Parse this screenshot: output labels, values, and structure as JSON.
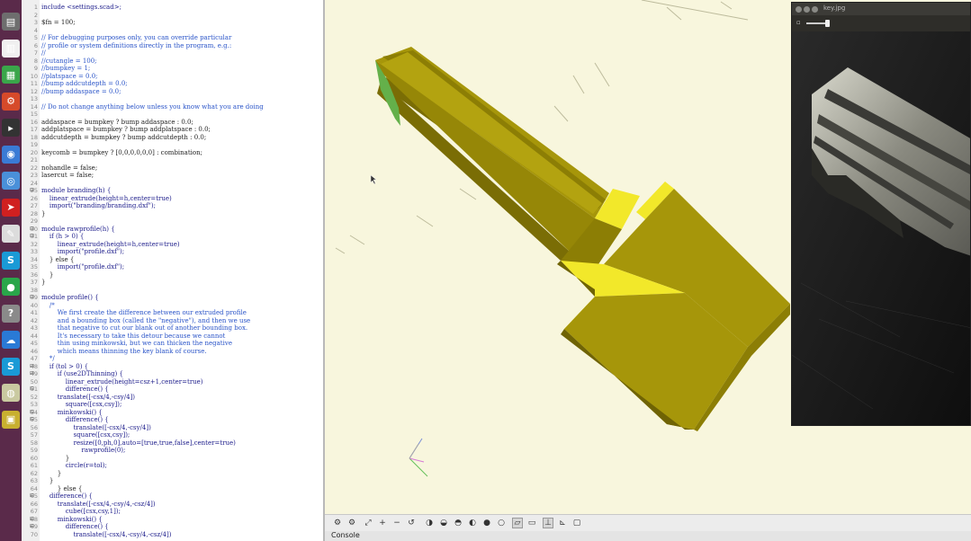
{
  "editor": {
    "lines": [
      {
        "n": "1",
        "text": "include <settings.scad>;",
        "style": "k"
      },
      {
        "n": "2",
        "text": "",
        "style": ""
      },
      {
        "n": "3",
        "text": "$fn = 100;",
        "style": ""
      },
      {
        "n": "4",
        "text": "",
        "style": ""
      },
      {
        "n": "5",
        "text": "// For debugging purposes only, you can override particular",
        "style": "c"
      },
      {
        "n": "6",
        "text": "// profile or system definitions directly in the program, e.g.:",
        "style": "c"
      },
      {
        "n": "7",
        "text": "//",
        "style": "c"
      },
      {
        "n": "8",
        "text": "//cutangle = 100;",
        "style": "c"
      },
      {
        "n": "9",
        "text": "//bumpkey = 1;",
        "style": "c"
      },
      {
        "n": "10",
        "text": "//platspace = 0.0;",
        "style": "c"
      },
      {
        "n": "11",
        "text": "//bump addcutdepth = 0.0;",
        "style": "c"
      },
      {
        "n": "12",
        "text": "//bump addaspace = 0.0;",
        "style": "c"
      },
      {
        "n": "13",
        "text": "",
        "style": ""
      },
      {
        "n": "14",
        "text": "// Do not change anything below unless you know what you are doing",
        "style": "c"
      },
      {
        "n": "15",
        "text": "",
        "style": ""
      },
      {
        "n": "16",
        "text": "addaspace = bumpkey ? bump addaspace : 0.0;",
        "style": ""
      },
      {
        "n": "17",
        "text": "addplatspace = bumpkey ? bump addplatspace : 0.0;",
        "style": ""
      },
      {
        "n": "18",
        "text": "addcutdepth = bumpkey ? bump addcutdepth : 0.0;",
        "style": ""
      },
      {
        "n": "19",
        "text": "",
        "style": ""
      },
      {
        "n": "20",
        "text": "keycomb = bumpkey ? [0,0,0,0,0,0] : combination;",
        "style": ""
      },
      {
        "n": "21",
        "text": "",
        "style": ""
      },
      {
        "n": "22",
        "text": "nohandle = false;",
        "style": ""
      },
      {
        "n": "23",
        "text": "lasercut = false;",
        "style": ""
      },
      {
        "n": "24",
        "text": "",
        "style": ""
      },
      {
        "n": "25",
        "text": "module branding(h) {",
        "style": "k",
        "fold": "⊟"
      },
      {
        "n": "26",
        "text": "    linear_extrude(height=h,center=true)",
        "style": "k"
      },
      {
        "n": "27",
        "text": "    import(\"branding/branding.dxf\");",
        "style": "k"
      },
      {
        "n": "28",
        "text": "}",
        "style": ""
      },
      {
        "n": "29",
        "text": "",
        "style": ""
      },
      {
        "n": "30",
        "text": "module rawprofile(h) {",
        "style": "k",
        "fold": "⊟"
      },
      {
        "n": "31",
        "text": "    if (h > 0) {",
        "style": "k",
        "fold": "⊟"
      },
      {
        "n": "32",
        "text": "        linear_extrude(height=h,center=true)",
        "style": "k"
      },
      {
        "n": "33",
        "text": "        import(\"profile.dxf\");",
        "style": "k"
      },
      {
        "n": "34",
        "text": "    } else {",
        "style": ""
      },
      {
        "n": "35",
        "text": "        import(\"profile.dxf\");",
        "style": "k"
      },
      {
        "n": "36",
        "text": "    }",
        "style": ""
      },
      {
        "n": "37",
        "text": "}",
        "style": ""
      },
      {
        "n": "38",
        "text": "",
        "style": ""
      },
      {
        "n": "39",
        "text": "module profile() {",
        "style": "k",
        "fold": "⊟"
      },
      {
        "n": "40",
        "text": "    /*",
        "style": "c"
      },
      {
        "n": "41",
        "text": "        We first create the difference between our extruded profile",
        "style": "c"
      },
      {
        "n": "42",
        "text": "        and a bounding box (called the \"negative\"), and then we use",
        "style": "c"
      },
      {
        "n": "43",
        "text": "        that negative to cut our blank out of another bounding box.",
        "style": "c"
      },
      {
        "n": "44",
        "text": "        It's necessary to take this detour because we cannot",
        "style": "c"
      },
      {
        "n": "45",
        "text": "        thin using minkowski, but we can thicken the negative",
        "style": "c"
      },
      {
        "n": "46",
        "text": "        which means thinning the key blank of course.",
        "style": "c"
      },
      {
        "n": "47",
        "text": "    */",
        "style": "c"
      },
      {
        "n": "48",
        "text": "    if (tol > 0) {",
        "style": "k",
        "fold": "⊟"
      },
      {
        "n": "49",
        "text": "        if (use2DThinning) {",
        "style": "k",
        "fold": "⊟"
      },
      {
        "n": "50",
        "text": "            linear_extrude(height=csz+1,center=true)",
        "style": "k"
      },
      {
        "n": "51",
        "text": "            difference() {",
        "style": "k",
        "fold": "⊟"
      },
      {
        "n": "52",
        "text": "        translate([-csx/4,-csy/4])",
        "style": "k"
      },
      {
        "n": "53",
        "text": "            square([csx,csy]);",
        "style": "k"
      },
      {
        "n": "54",
        "text": "        minkowski() {",
        "style": "k",
        "fold": "⊟"
      },
      {
        "n": "55",
        "text": "            difference() {",
        "style": "k",
        "fold": "⊟"
      },
      {
        "n": "56",
        "text": "                translate([-csx/4,-csy/4])",
        "style": "k"
      },
      {
        "n": "57",
        "text": "                square([csx,csy]);",
        "style": "k"
      },
      {
        "n": "58",
        "text": "                resize([0,ph,0],auto=[true,true,false],center=true)",
        "style": "k"
      },
      {
        "n": "59",
        "text": "                    rawprofile(0);",
        "style": "k"
      },
      {
        "n": "60",
        "text": "            }",
        "style": ""
      },
      {
        "n": "61",
        "text": "            circle(r=tol);",
        "style": "k"
      },
      {
        "n": "62",
        "text": "        }",
        "style": ""
      },
      {
        "n": "63",
        "text": "    }",
        "style": ""
      },
      {
        "n": "64",
        "text": "        } else {",
        "style": ""
      },
      {
        "n": "65",
        "text": "    difference() {",
        "style": "k",
        "fold": "⊟"
      },
      {
        "n": "66",
        "text": "        translate([-csx/4,-csy/4,-csz/4])",
        "style": "k"
      },
      {
        "n": "67",
        "text": "            cube([csx,csy,1]);",
        "style": "k"
      },
      {
        "n": "68",
        "text": "        minkowski() {",
        "style": "k",
        "fold": "⊟"
      },
      {
        "n": "69",
        "text": "            difference() {",
        "style": "k",
        "fold": "⊟"
      },
      {
        "n": "70",
        "text": "                translate([-csx/4,-csy/4,-csz/4])",
        "style": "k"
      }
    ]
  },
  "viewer": {
    "title": "key.jpg"
  },
  "console": {
    "label": "Console"
  },
  "launcher_icons": [
    {
      "name": "files-icon",
      "color": "#6e6e6e"
    },
    {
      "name": "document-icon",
      "color": "#f0f0f0"
    },
    {
      "name": "spreadsheet-icon",
      "color": "#3aa64a"
    },
    {
      "name": "settings-icon",
      "color": "#d64a2a"
    },
    {
      "name": "terminal-icon",
      "color": "#333333"
    },
    {
      "name": "browser-icon",
      "color": "#3a7bd5"
    },
    {
      "name": "chrome-icon",
      "color": "#4a90d9"
    },
    {
      "name": "telegram-icon",
      "color": "#d02020"
    },
    {
      "name": "editor-icon",
      "color": "#dcdcdc"
    },
    {
      "name": "skype-icon",
      "color": "#1a9ad6"
    },
    {
      "name": "app-green-icon",
      "color": "#2aa64a"
    },
    {
      "name": "help-icon",
      "color": "#8a8a8a"
    },
    {
      "name": "cloud-icon",
      "color": "#2a7ad6"
    },
    {
      "name": "skype-alt-icon",
      "color": "#1a9ad6"
    },
    {
      "name": "disk-icon",
      "color": "#c9c9a0"
    },
    {
      "name": "files-yellow-icon",
      "color": "#c8b030"
    }
  ],
  "colors": {
    "viewport_bg": "#f8f6dd",
    "model_face": "#a6960a",
    "model_top": "#f2e82a",
    "model_side": "#7a6d05",
    "model_cut": "#64b04a"
  }
}
